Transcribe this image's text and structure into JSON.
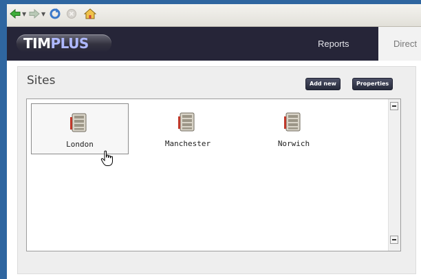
{
  "browser": {
    "icons": [
      "back-arrow-icon",
      "forward-arrow-icon",
      "refresh-icon",
      "stop-icon",
      "home-icon"
    ]
  },
  "app": {
    "logo_tim": "TIM",
    "logo_plus": "PLUS",
    "nav": {
      "reports": "Reports",
      "directory": "Direct"
    }
  },
  "sites": {
    "title": "Sites",
    "add_new_label": "Add new",
    "properties_label": "Properties",
    "items": [
      {
        "label": "London",
        "selected": true
      },
      {
        "label": "Manchester",
        "selected": false
      },
      {
        "label": "Norwich",
        "selected": false
      }
    ]
  },
  "colors": {
    "desktop": "#2f66a0",
    "appbar": "#262538",
    "logo_plus": "#aeb8ff"
  }
}
